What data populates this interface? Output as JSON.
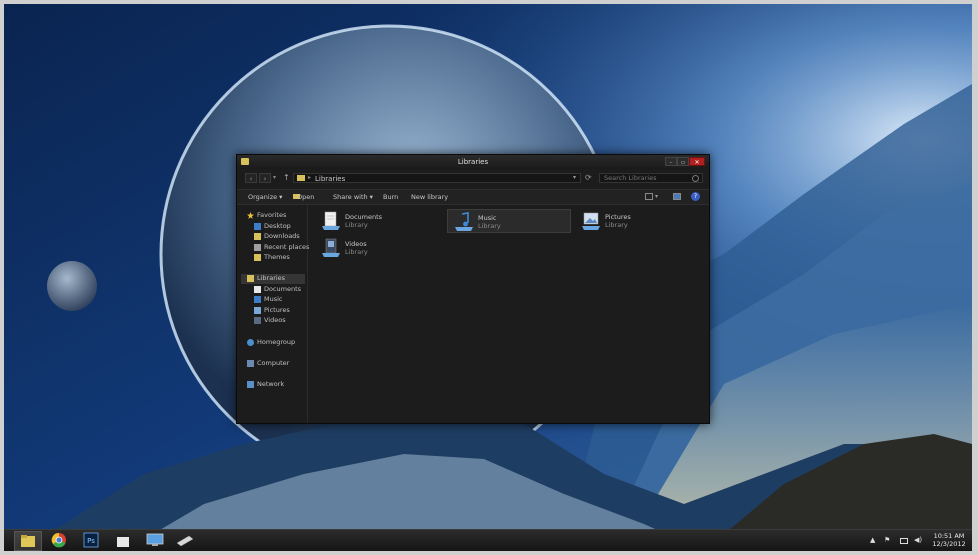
{
  "window": {
    "title": "Libraries",
    "address": "Libraries",
    "search_placeholder": "Search Libraries",
    "nav_back": "‹",
    "nav_forward": "›",
    "nav_recent": "▾",
    "nav_up": "↑",
    "address_sep": "▸",
    "address_drop": "▾",
    "refresh": "⟳",
    "min": "–",
    "max": "▫",
    "close": "✕"
  },
  "commands": {
    "organize": "Organize ▾",
    "open": "Open",
    "share_with": "Share with ▾",
    "burn": "Burn",
    "new_library": "New library",
    "view_drop": "▾",
    "help": "?"
  },
  "sidebar": {
    "favorites": "Favorites",
    "favorites_items": [
      "Desktop",
      "Downloads",
      "Recent places",
      "Themes"
    ],
    "libraries": "Libraries",
    "libraries_items": [
      "Documents",
      "Music",
      "Pictures",
      "Videos"
    ],
    "homegroup": "Homegroup",
    "computer": "Computer",
    "network": "Network"
  },
  "libraries": [
    {
      "name": "Documents",
      "type": "Library"
    },
    {
      "name": "Music",
      "type": "Library"
    },
    {
      "name": "Pictures",
      "type": "Library"
    },
    {
      "name": "Videos",
      "type": "Library"
    }
  ],
  "taskbar": {
    "apps": [
      "explorer-icon",
      "chrome-icon",
      "photoshop-icon",
      "calendar-icon",
      "remote-desktop-icon",
      "drive-icon"
    ],
    "photoshop_label": "Ps",
    "time": "10:51 AM",
    "date": "12/3/2012",
    "tray_arrow": "▲",
    "flag": "⚑",
    "speaker": "◀)"
  },
  "colors": {
    "window_bg": "#1c1c1c",
    "close_red": "#b02020",
    "folder_yellow": "#d8c05a"
  }
}
